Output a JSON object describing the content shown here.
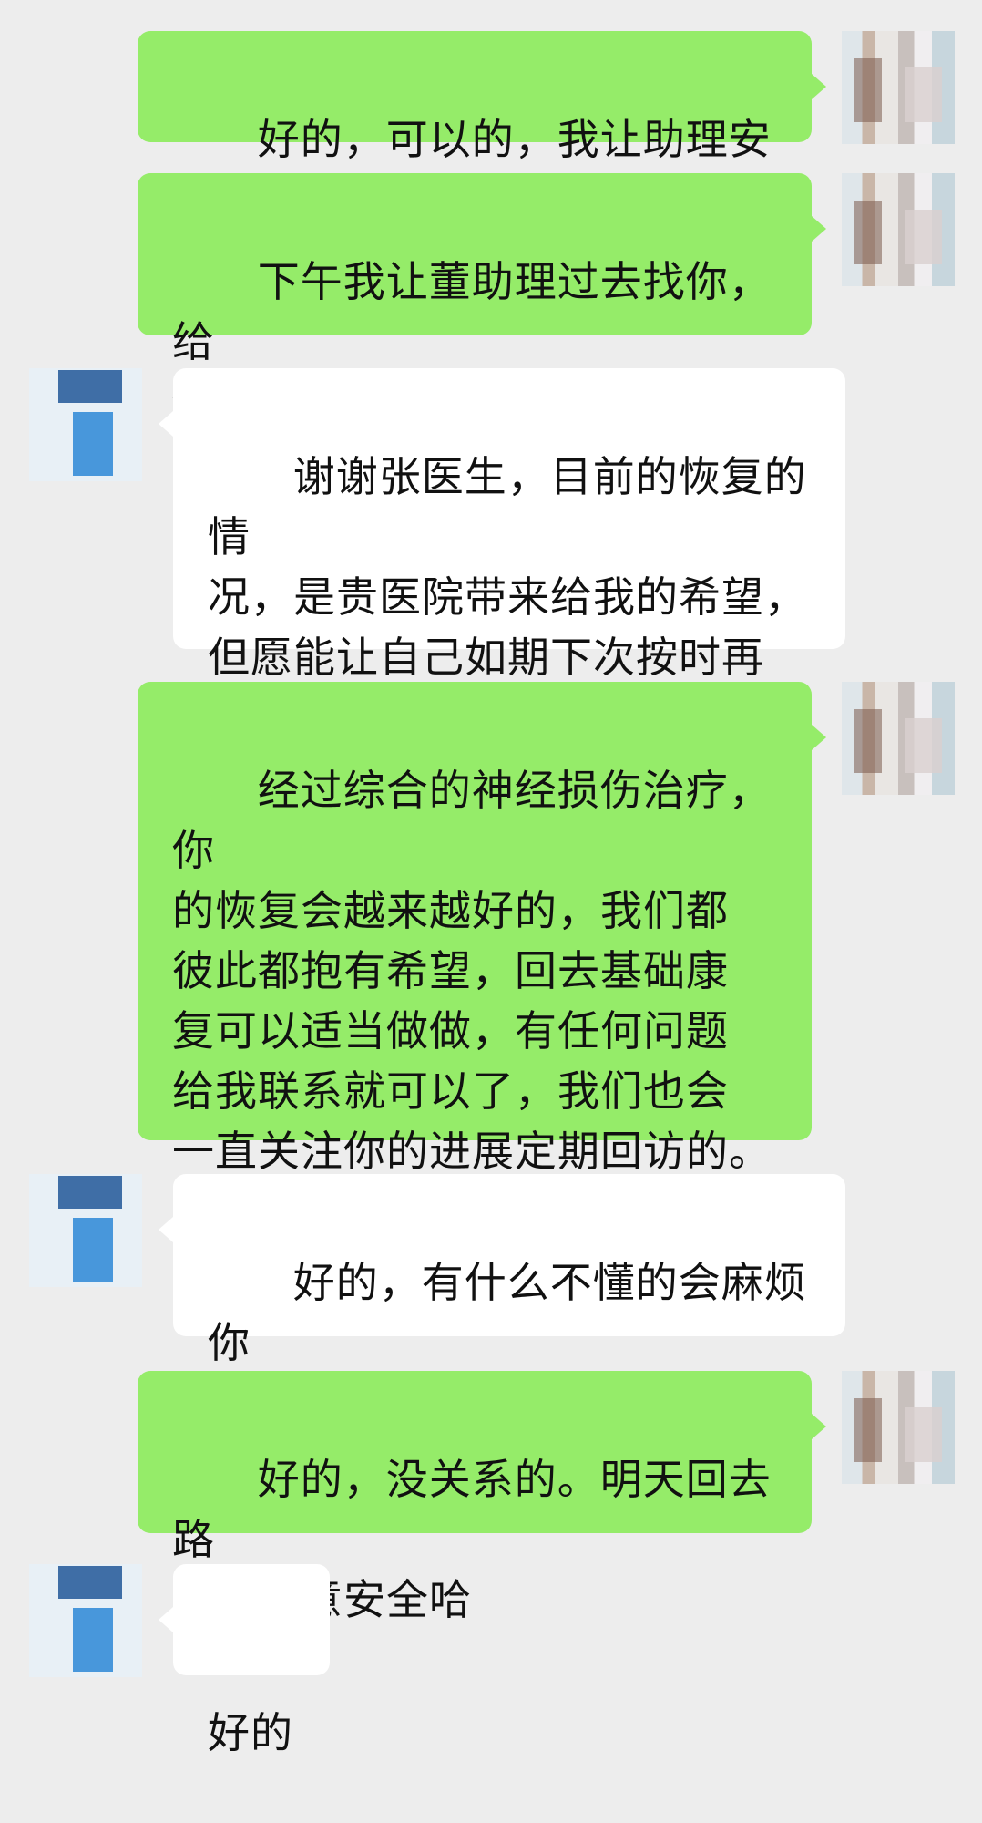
{
  "messages": [
    {
      "side": "out",
      "text": "好的，可以的，我让助理安排"
    },
    {
      "side": "out",
      "text": "下午我让董助理过去找你，给\n你安排"
    },
    {
      "side": "in",
      "text": "谢谢张医生，目前的恢复的情\n况，是贵医院带来给我的希望，\n但愿能让自己如期下次按时再\n来接受治疗"
    },
    {
      "side": "out",
      "text": "经过综合的神经损伤治疗，你\n的恢复会越来越好的，我们都\n彼此都抱有希望，回去基础康\n复可以适当做做，有任何问题\n给我联系就可以了，我们也会\n一直关注你的进展定期回访的。\n加油",
      "emoji": "✊"
    },
    {
      "side": "in",
      "text": "好的，有什么不懂的会麻烦你\n们的，"
    },
    {
      "side": "out",
      "text": "好的，没关系的。明天回去路\n上也注意安全哈"
    },
    {
      "side": "in",
      "text": "好的"
    }
  ],
  "colors": {
    "background": "#ededed",
    "sent_bubble": "#95ec69",
    "received_bubble": "#ffffff"
  },
  "icons": {
    "doctor_avatar": "doctor-avatar-blurred",
    "patient_avatar": "patient-avatar-blurred",
    "emoji": "raised-fist"
  }
}
